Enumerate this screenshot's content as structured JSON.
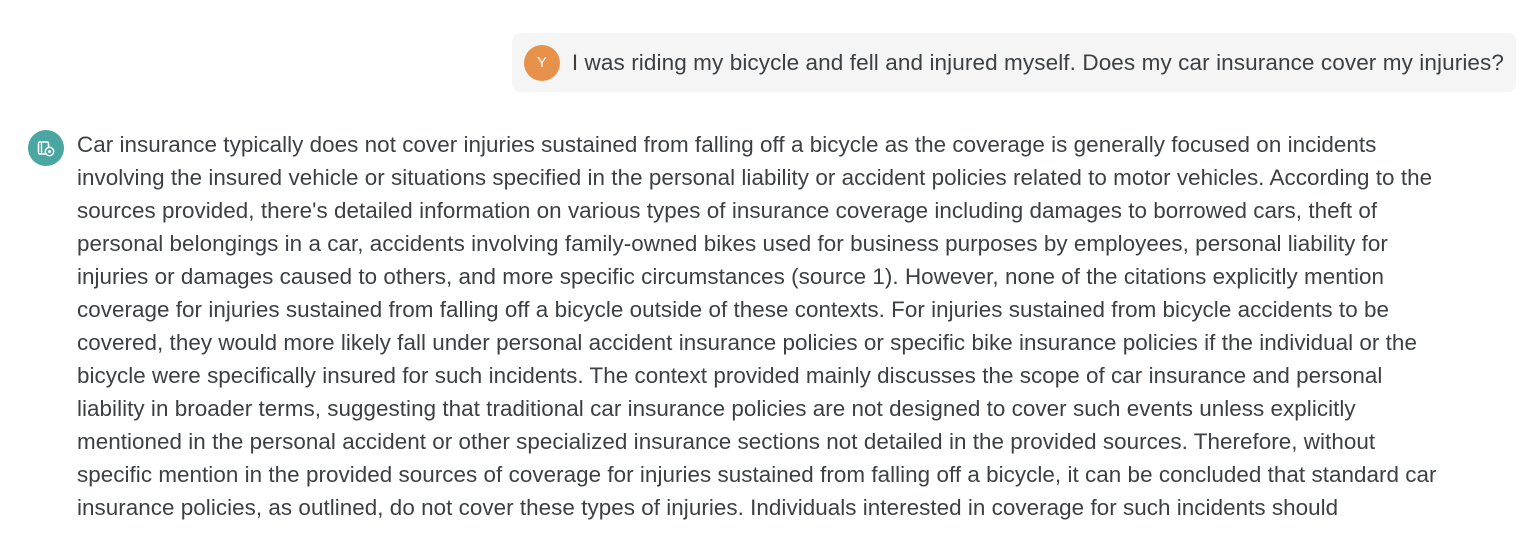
{
  "user_message": {
    "avatar_letter": "Y",
    "text": "I was riding my bicycle and fell and injured myself. Does my car insurance cover my injuries?"
  },
  "assistant_message": {
    "avatar_icon": "assistant-settings-icon",
    "text": "Car insurance typically does not cover injuries sustained from falling off a bicycle as the coverage is generally focused on incidents involving the insured vehicle or situations specified in the personal liability or accident policies related to motor vehicles. According to the sources provided, there's detailed information on various types of insurance coverage including damages to borrowed cars, theft of personal belongings in a car, accidents involving family-owned bikes used for business purposes by employees, personal liability for injuries or damages caused to others, and more specific circumstances (source 1). However, none of the citations explicitly mention coverage for injuries sustained from falling off a bicycle outside of these contexts. For injuries sustained from bicycle accidents to be covered, they would more likely fall under personal accident insurance policies or specific bike insurance policies if the individual or the bicycle were specifically insured for such incidents. The context provided mainly discusses the scope of car insurance and personal liability in broader terms, suggesting that traditional car insurance policies are not designed to cover such events unless explicitly mentioned in the personal accident or other specialized insurance sections not detailed in the provided sources. Therefore, without specific mention in the provided sources of coverage for injuries sustained from falling off a bicycle, it can be concluded that standard car insurance policies, as outlined, do not cover these types of injuries. Individuals interested in coverage for such incidents should"
  },
  "colors": {
    "user_avatar": "#e8914a",
    "assistant_avatar": "#4aa6a0",
    "user_bubble": "#f5f5f5",
    "text": "#3c4043"
  }
}
